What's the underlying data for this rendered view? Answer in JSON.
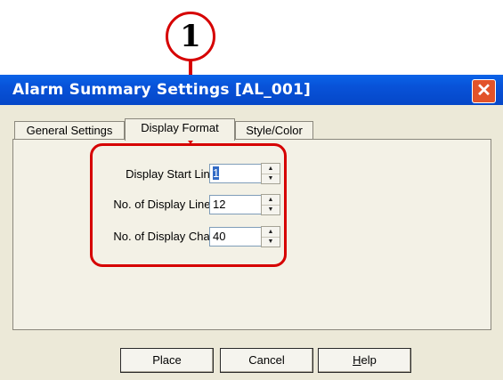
{
  "callout": {
    "number": "1"
  },
  "window": {
    "title": "Alarm Summary Settings [AL_001]",
    "close_symbol": "✕"
  },
  "tabs": [
    {
      "label": "General Settings",
      "active": false
    },
    {
      "label": "Display Format",
      "active": true
    },
    {
      "label": "Style/Color",
      "active": false
    }
  ],
  "fields": {
    "display_start_line": {
      "label": "Display Start Line",
      "value": "1"
    },
    "display_lines": {
      "label": "No. of Display Lines",
      "value": "12"
    },
    "display_char": {
      "label": "No. of Display Char.",
      "value": "40"
    }
  },
  "buttons": {
    "place": "Place",
    "cancel": "Cancel",
    "help_first": "H",
    "help_rest": "elp"
  },
  "icons": {
    "spin_up": "▲",
    "spin_down": "▼"
  },
  "colors": {
    "title_bar": "#0852d8",
    "highlight": "#d60000",
    "close_button": "#e2532a"
  }
}
